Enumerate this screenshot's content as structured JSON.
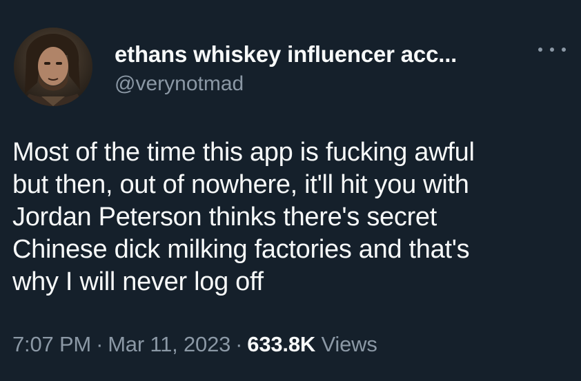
{
  "tweet": {
    "author": {
      "display_name": "ethans whiskey influencer acc...",
      "handle": "@verynotmad",
      "avatar_icon": "profile-photo"
    },
    "more_icon": "more-options-icon",
    "text": "Most of the time this app is fucking awful\nbut then, out of nowhere, it'll hit you with\nJordan Peterson thinks there's secret\nChinese dick milking factories and that's\nwhy I will never log off",
    "meta": {
      "time": "7:07 PM",
      "separator": "·",
      "date": "Mar 11, 2023",
      "views_count": "633.8K",
      "views_label": "Views"
    }
  },
  "colors": {
    "background": "#15202b",
    "primary_text": "#f7f9f9",
    "secondary_text": "#8b98a5"
  }
}
